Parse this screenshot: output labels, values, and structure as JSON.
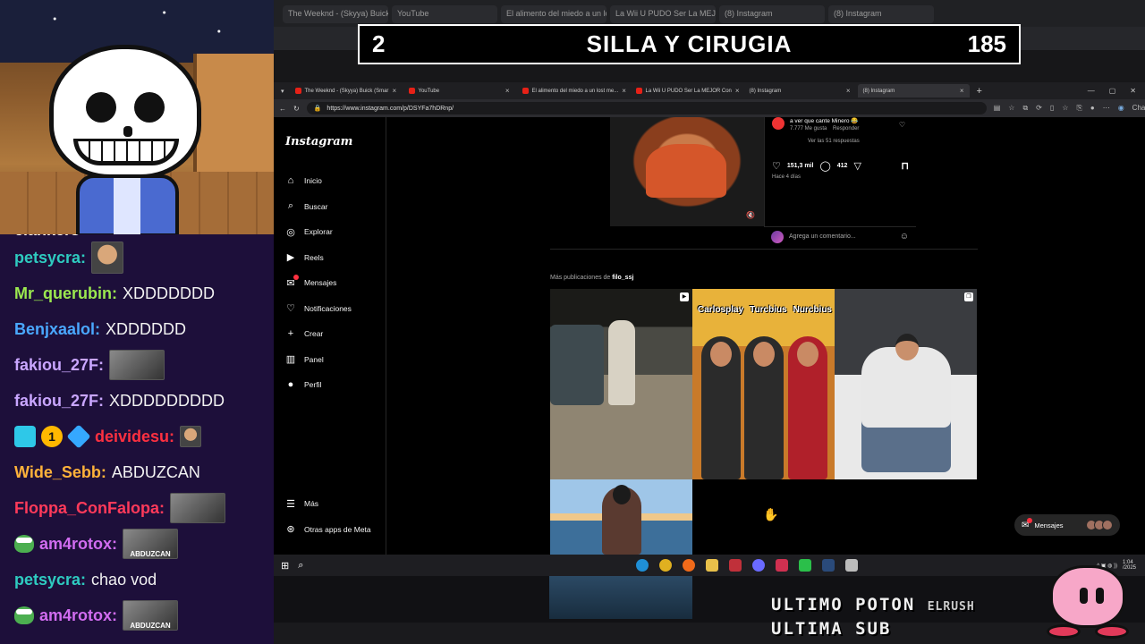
{
  "banner": {
    "rank": "2",
    "title": "SILLA Y CIRUGIA",
    "score": "185"
  },
  "chat": [
    {
      "user": "clankers",
      "color": "#ffffff",
      "msg": "",
      "emote": "",
      "cut": true
    },
    {
      "user": "petsycra:",
      "color": "#2ecbc0",
      "msg": "",
      "emote": "face"
    },
    {
      "user": "Mr_querubin:",
      "color": "#9be84f",
      "msg": "XDDDDDDD",
      "emote": ""
    },
    {
      "user": "Benjxaalol:",
      "color": "#4aa8ff",
      "msg": "XDDDDDD",
      "emote": ""
    },
    {
      "user": "fakiou_27F:",
      "color": "#c9a6ff",
      "msg": "",
      "emote": "img"
    },
    {
      "user": "fakiou_27F:",
      "color": "#c9a6ff",
      "msg": "XDDDDDDDDD",
      "emote": ""
    },
    {
      "user": "deividesu:",
      "color": "#ff3040",
      "msg": "",
      "emote": "small",
      "badges": true
    },
    {
      "user": "Wide_Sebb:",
      "color": "#ffb23a",
      "msg": "ABDUZCAN",
      "emote": ""
    },
    {
      "user": "Floppa_ConFalopa:",
      "color": "#ff3a5a",
      "msg": "",
      "emote": "img"
    },
    {
      "user": "am4rotox:",
      "color": "#d16cf0",
      "msg": "",
      "emote": "cap",
      "caption": "ABDUZCAN",
      "pepe": true
    },
    {
      "user": "petsycra:",
      "color": "#2ecbc0",
      "msg": "chao vod",
      "emote": ""
    },
    {
      "user": "am4rotox:",
      "color": "#d16cf0",
      "msg": "",
      "emote": "cap",
      "caption": "ABDUZCAN",
      "pepe": true
    }
  ],
  "ghost_tabs": [
    "The Weeknd - (Skyya) Buick Flash",
    "YouTube",
    "El alimento del miedo a un lost me",
    "La Wii U PUDO Ser La MEJOR Con",
    "(8) Instagram",
    "(8) Instagram"
  ],
  "browser": {
    "tabs": [
      {
        "label": "The Weeknd - (Skyya) Buick (Smar",
        "icon": "yt"
      },
      {
        "label": "YouTube",
        "icon": "yt"
      },
      {
        "label": "El alimento del miedo a un lost me...",
        "icon": "yt"
      },
      {
        "label": "La Wii U PUDO Ser La MEJOR Con",
        "icon": "yt"
      },
      {
        "label": "(8) Instagram",
        "icon": "ig"
      },
      {
        "label": "(8) Instagram",
        "icon": "ig",
        "active": true
      }
    ],
    "url": "https://www.instagram.com/p/DSYFa7hDRnp/",
    "chat_label": "Chat"
  },
  "instagram": {
    "logo": "Instagram",
    "nav": [
      "Inicio",
      "Buscar",
      "Explorar",
      "Reels",
      "Mensajes",
      "Notificaciones",
      "Crear",
      "Panel",
      "Perfil"
    ],
    "nav_bottom": [
      "Más",
      "Otras apps de Meta"
    ],
    "comment": {
      "text": "a ver que cante Minero 😂",
      "likes": "7.777 Me gusta",
      "reply": "Responder",
      "replies": "Ver las 51 respuestas"
    },
    "likes_count": "151,3 mil",
    "comments_count": "412",
    "ago": "Hace 4 días",
    "add_comment": "Agrega un comentario...",
    "more_label": "Más publicaciones de",
    "more_user": "filo_ssj",
    "tile_captions": [
      "Carlosplay",
      "Turcbius",
      "Nurcbius"
    ],
    "messages_pill": "Mensajes"
  },
  "taskbar": {
    "time": "1:04",
    "date": "/2025"
  },
  "overlay": {
    "line1": "ULTIMO POTON",
    "line2": "ULTIMA SUB",
    "user": "ELRUSH"
  }
}
